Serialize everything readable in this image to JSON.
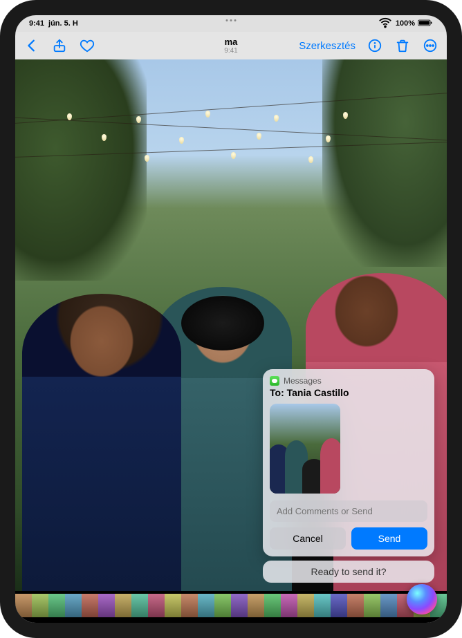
{
  "status": {
    "time": "9:41",
    "date": "jún. 5. H",
    "battery_pct": "100%",
    "wifi": "wifi-icon",
    "battery": "battery-icon"
  },
  "toolbar": {
    "date_label": "ma",
    "time_label": "9:41",
    "edit_label": "Szerkesztés"
  },
  "siri": {
    "app_label": "Messages",
    "to_prefix": "To:",
    "recipient": "Tania Castillo",
    "comment_placeholder": "Add Comments or Send",
    "cancel_label": "Cancel",
    "send_label": "Send",
    "prompt_text": "Ready to send it?"
  },
  "colors": {
    "accent": "#007aff",
    "messages_green": "#2bb82a"
  },
  "thumbnail_strip_count": 28
}
